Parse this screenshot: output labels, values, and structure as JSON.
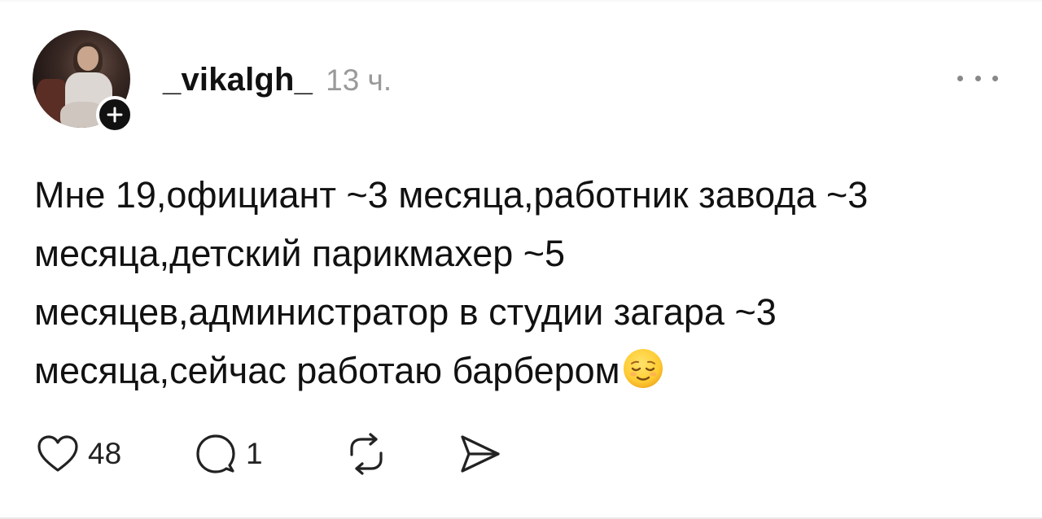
{
  "post": {
    "author": {
      "username": "_vikalgh_",
      "avatar_icon": "avatar-photo",
      "follow_icon": "plus-icon"
    },
    "timestamp": "13 ч.",
    "more_icon": "ellipsis-icon",
    "text": "Мне 19,официант ~3 месяца,работник завода ~3\nмесяца,детский парикмахер ~5\nмесяцев,администратор в студии загара ~3\nмесяца,сейчас работаю барбером",
    "emoji": "relieved-face-emoji",
    "actions": {
      "like_icon": "heart-icon",
      "like_count": "48",
      "reply_icon": "comment-icon",
      "reply_count": "1",
      "repost_icon": "repost-icon",
      "share_icon": "send-icon"
    }
  },
  "colors": {
    "text": "#111111",
    "muted": "#9a9a9a",
    "icon": "#222222"
  }
}
